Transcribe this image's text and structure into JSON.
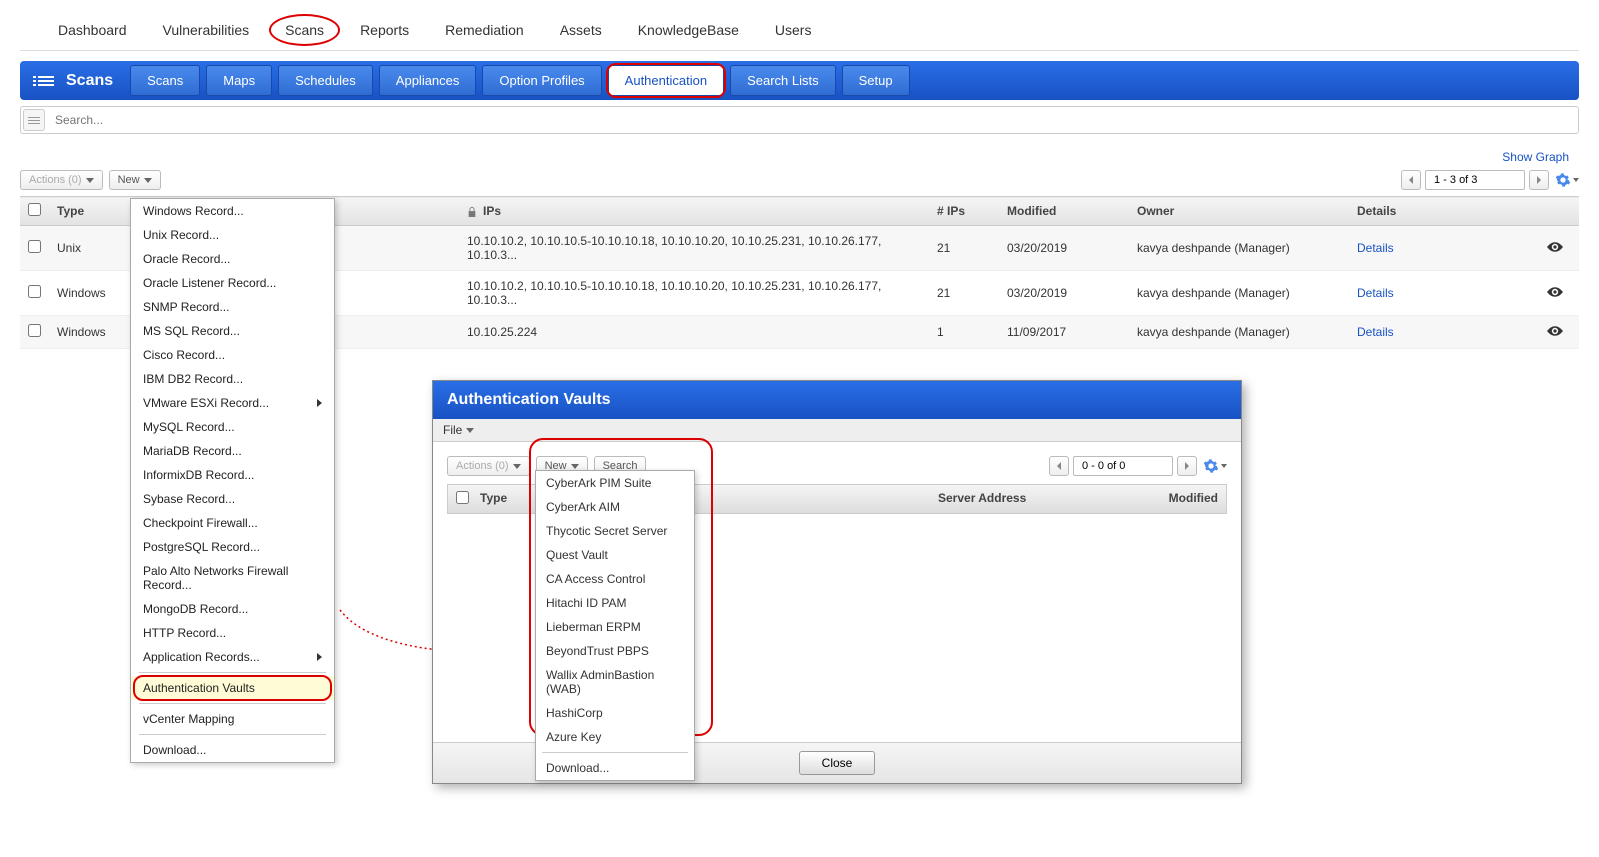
{
  "topnav": [
    "Dashboard",
    "Vulnerabilities",
    "Scans",
    "Reports",
    "Remediation",
    "Assets",
    "KnowledgeBase",
    "Users"
  ],
  "topnav_circled_index": 2,
  "section_title": "Scans",
  "blue_tabs": [
    "Scans",
    "Maps",
    "Schedules",
    "Appliances",
    "Option Profiles",
    "Authentication",
    "Search Lists",
    "Setup"
  ],
  "blue_tab_active_index": 5,
  "search": {
    "placeholder": "Search..."
  },
  "show_graph": "Show Graph",
  "actions_btn": "Actions (0)",
  "new_btn": "New",
  "pager_main": "1 - 3 of 3",
  "table": {
    "columns": [
      "Type",
      "IPs",
      "# IPs",
      "Modified",
      "Owner",
      "Details"
    ],
    "rows": [
      {
        "type": "Unix",
        "ips": "10.10.10.2, 10.10.10.5-10.10.10.18, 10.10.10.20, 10.10.25.231, 10.10.26.177, 10.10.3...",
        "count": "21",
        "modified": "03/20/2019",
        "owner": "kavya deshpande (Manager)",
        "details": "Details"
      },
      {
        "type": "Windows",
        "ips": "10.10.10.2, 10.10.10.5-10.10.10.18, 10.10.10.20, 10.10.25.231, 10.10.26.177, 10.10.3...",
        "count": "21",
        "modified": "03/20/2019",
        "owner": "kavya deshpande (Manager)",
        "details": "Details"
      },
      {
        "type": "Windows",
        "ips": "10.10.25.224",
        "count": "1",
        "modified": "11/09/2017",
        "owner": "kavya deshpande (Manager)",
        "details": "Details"
      }
    ]
  },
  "new_menu": [
    {
      "label": "Windows Record..."
    },
    {
      "label": "Unix Record..."
    },
    {
      "label": "Oracle Record..."
    },
    {
      "label": "Oracle Listener Record..."
    },
    {
      "label": "SNMP Record..."
    },
    {
      "label": "MS SQL Record..."
    },
    {
      "label": "Cisco Record..."
    },
    {
      "label": "IBM DB2 Record..."
    },
    {
      "label": "VMware ESXi Record...",
      "sub": true
    },
    {
      "label": "MySQL Record..."
    },
    {
      "label": "MariaDB Record..."
    },
    {
      "label": "InformixDB Record..."
    },
    {
      "label": "Sybase Record..."
    },
    {
      "label": "Checkpoint Firewall..."
    },
    {
      "label": "PostgreSQL Record..."
    },
    {
      "label": "Palo Alto Networks Firewall Record..."
    },
    {
      "label": "MongoDB Record..."
    },
    {
      "label": "HTTP Record..."
    },
    {
      "label": "Application Records...",
      "sub": true
    },
    {
      "divider": true
    },
    {
      "label": "Authentication Vaults",
      "highlighted": true,
      "circled": true
    },
    {
      "divider": true
    },
    {
      "label": "vCenter Mapping"
    },
    {
      "divider": true
    },
    {
      "label": "Download..."
    }
  ],
  "dialog": {
    "title": "Authentication Vaults",
    "file_label": "File",
    "actions_btn": "Actions (0)",
    "new_btn": "New",
    "search_btn": "Search",
    "pager": "0 - 0 of 0",
    "columns": {
      "type": "Type",
      "server_address": "Server Address",
      "modified": "Modified"
    },
    "close": "Close",
    "vault_menu": [
      {
        "label": "CyberArk PIM Suite"
      },
      {
        "label": "CyberArk AIM"
      },
      {
        "label": "Thycotic Secret Server"
      },
      {
        "label": "Quest Vault"
      },
      {
        "label": "CA Access Control"
      },
      {
        "label": "Hitachi ID PAM"
      },
      {
        "label": "Lieberman ERPM"
      },
      {
        "label": "BeyondTrust PBPS"
      },
      {
        "label": "Wallix AdminBastion (WAB)"
      },
      {
        "label": "HashiCorp"
      },
      {
        "label": "Azure Key"
      },
      {
        "divider": true
      },
      {
        "label": "Download..."
      }
    ]
  }
}
